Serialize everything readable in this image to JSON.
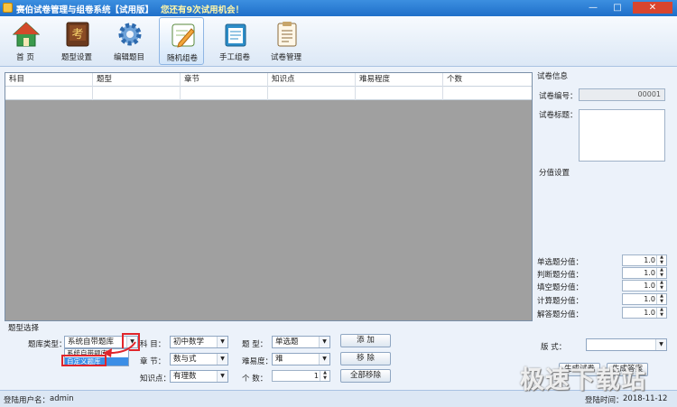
{
  "window": {
    "title": "赛伯试卷管理与组卷系统【试用版】",
    "trial_notice": "您还有9次试用机会！",
    "min": "—",
    "max": "□",
    "close": "✕"
  },
  "toolbar": [
    {
      "label": "首 页",
      "icon": "home-icon"
    },
    {
      "label": "题型设置",
      "icon": "exam-book-icon"
    },
    {
      "label": "编辑题目",
      "icon": "gear-icon"
    },
    {
      "label": "随机组卷",
      "icon": "edit-note-icon",
      "active": true
    },
    {
      "label": "手工组卷",
      "icon": "clipboard-icon"
    },
    {
      "label": "试卷管理",
      "icon": "document-icon"
    }
  ],
  "grid": {
    "columns": [
      "科目",
      "题型",
      "章节",
      "知识点",
      "难易程度",
      "个数"
    ]
  },
  "paper_info": {
    "title": "试卷信息",
    "number_label": "试卷编号：",
    "number_value": "00001",
    "title_label": "试卷标题："
  },
  "score_settings": {
    "title": "分值设置",
    "rows": [
      {
        "label": "单选题分值：",
        "value": "1.0"
      },
      {
        "label": "判断题分值：",
        "value": "1.0"
      },
      {
        "label": "填空题分值：",
        "value": "1.0"
      },
      {
        "label": "计算题分值：",
        "value": "1.0"
      },
      {
        "label": "解答题分值：",
        "value": "1.0"
      }
    ]
  },
  "layout": {
    "label": "版  式：",
    "value": ""
  },
  "actions": {
    "generate": "生成试卷",
    "answer": "生成答案"
  },
  "question_select": {
    "title": "题型选择",
    "bank_type_label": "题库类型：",
    "bank_type_value": "系统自带题库",
    "bank_options": [
      "系统自带题库",
      "自定义题库"
    ],
    "subject_label": "科  目：",
    "subject_value": "初中数学",
    "chapter_label": "章  节：",
    "chapter_value": "数与式",
    "knowledge_label": "知识点：",
    "knowledge_value": "有理数",
    "qtype_label": "题  型：",
    "qtype_value": "单选题",
    "difficulty_label": "难易度：",
    "difficulty_value": "难",
    "count_label": "个  数：",
    "count_value": "1",
    "add": "添  加",
    "remove": "移  除",
    "remove_all": "全部移除"
  },
  "status": {
    "user_label": "登陆用户名：",
    "user_value": "admin",
    "time_label": "登陆时间：",
    "time_value": "2018-11-12"
  },
  "watermark": "极速下载站",
  "colors": {
    "titlebar": "#1F6FC9",
    "grid_bg": "#A0A0A0",
    "highlight": "#E0252B",
    "dropdown_select": "#3B8EE6"
  }
}
